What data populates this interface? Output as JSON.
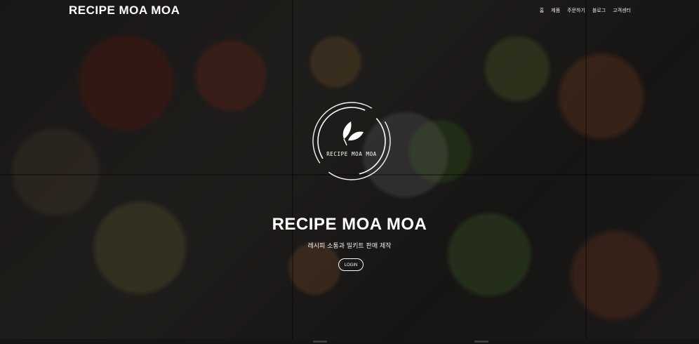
{
  "header": {
    "logo": "RECIPE MOA MOA",
    "nav": [
      "홈",
      "제품",
      "주문하기",
      "블로그",
      "고객센터"
    ]
  },
  "hero": {
    "emblem_text": "RECIPE MOA MOA",
    "emblem_icon": "leaf-icon",
    "title": "RECIPE MOA MOA",
    "subtitle": "레시피 소통과 밀키트 판매 제작",
    "login_label": "LOGIN"
  },
  "colors": {
    "text": "#ffffff",
    "overlay": "#000000"
  }
}
